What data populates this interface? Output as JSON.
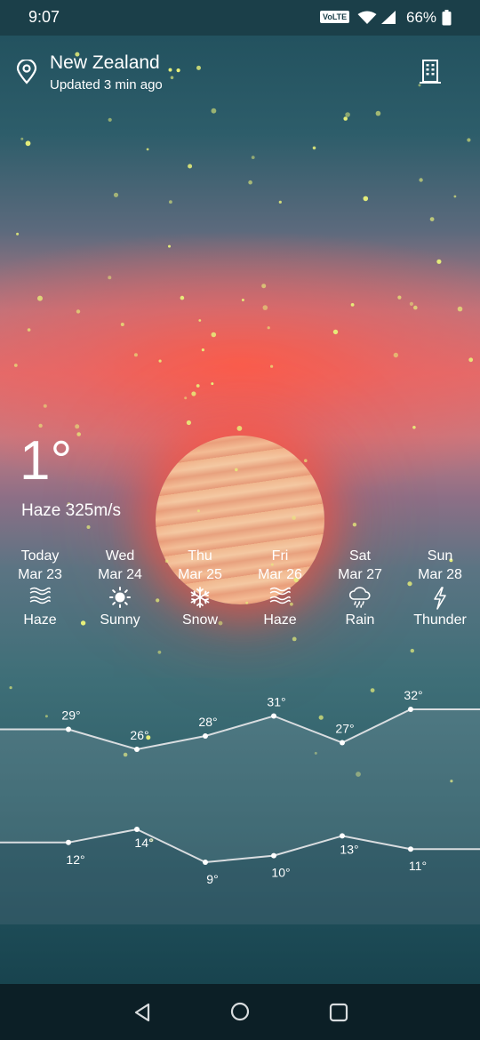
{
  "status_bar": {
    "time": "9:07",
    "network_badge": "VoLTE",
    "battery_percent": "66%",
    "icons": [
      "wifi-icon",
      "signal-icon",
      "battery-icon"
    ]
  },
  "header": {
    "location": "New Zealand",
    "updated": "Updated 3 min ago",
    "icons": [
      "location-pin-icon",
      "city-building-icon"
    ]
  },
  "current": {
    "temperature": "1°",
    "condition": "Haze 325m/s"
  },
  "forecast": [
    {
      "day": "Today",
      "date": "Mar 23",
      "icon": "haze-icon",
      "condition": "Haze",
      "high": "29°",
      "low": "12°"
    },
    {
      "day": "Wed",
      "date": "Mar 24",
      "icon": "sunny-icon",
      "condition": "Sunny",
      "high": "26°",
      "low": "14°"
    },
    {
      "day": "Thu",
      "date": "Mar 25",
      "icon": "snow-icon",
      "condition": "Snow",
      "high": "28°",
      "low": "9°"
    },
    {
      "day": "Fri",
      "date": "Mar 26",
      "icon": "haze-icon",
      "condition": "Haze",
      "high": "31°",
      "low": "10°"
    },
    {
      "day": "Sat",
      "date": "Mar 27",
      "icon": "rain-icon",
      "condition": "Rain",
      "high": "27°",
      "low": "13°"
    },
    {
      "day": "Sun",
      "date": "Mar 28",
      "icon": "thunder-icon",
      "condition": "Thunder",
      "high": "32°",
      "low": "11°"
    }
  ],
  "chart_data": {
    "type": "line",
    "categories": [
      "Mar 23",
      "Mar 24",
      "Mar 25",
      "Mar 26",
      "Mar 27",
      "Mar 28"
    ],
    "series": [
      {
        "values": [
          29,
          26,
          28,
          31,
          27,
          32
        ]
      },
      {
        "values": [
          12,
          14,
          9,
          10,
          13,
          11
        ]
      }
    ],
    "unit": "°",
    "title": "",
    "xlabel": "",
    "ylabel": ""
  },
  "nav_bar": {
    "icons": [
      "back-icon",
      "home-icon",
      "recent-apps-icon"
    ]
  },
  "colors": {
    "status_bar_bg": "#1b3f49",
    "nav_bar_bg": "#0c1f26",
    "sky_glow": "#e06f70",
    "chart_line": "#d9dde0"
  }
}
